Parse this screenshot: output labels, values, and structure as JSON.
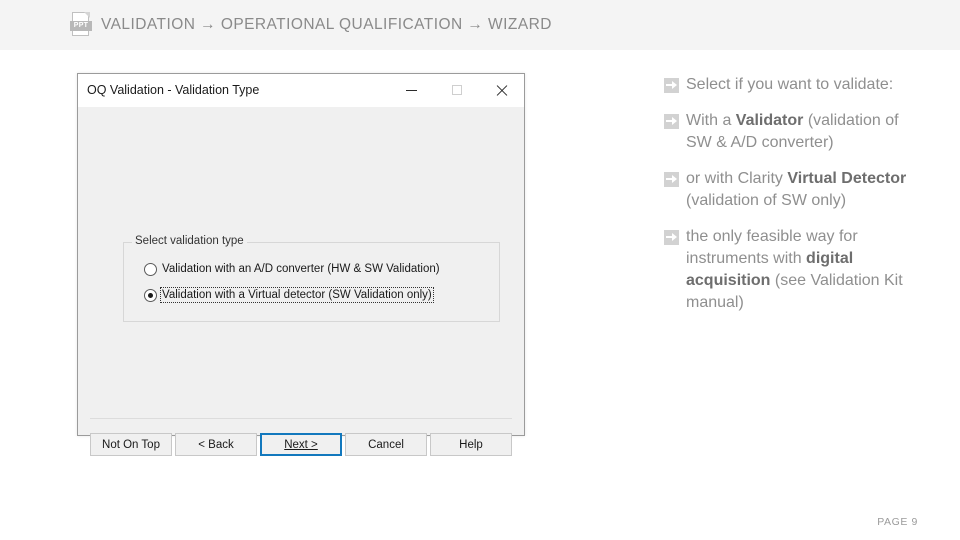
{
  "banner": {
    "icon_name": "ppt-file-icon",
    "icon_label": "PPT",
    "breadcrumb": "VALIDATION → OPERATIONAL QUALIFICATION → WIZARD"
  },
  "dialog": {
    "title": "OQ Validation - Validation Type",
    "window_controls": {
      "minimize": "—",
      "maximize": "□",
      "close": "✕"
    },
    "groupbox": {
      "label": "Select validation type",
      "options": [
        {
          "label": "Validation with an A/D converter (HW & SW Validation)",
          "selected": false,
          "focused": false
        },
        {
          "label": "Validation with a Virtual detector (SW Validation only)",
          "selected": true,
          "focused": true
        }
      ]
    },
    "buttons": [
      {
        "label": "Not On Top",
        "focused": false,
        "accel": ""
      },
      {
        "label": "< Back",
        "focused": false,
        "accel": "B"
      },
      {
        "label": "Next >",
        "focused": true,
        "accel": "N"
      },
      {
        "label": "Cancel",
        "focused": false,
        "accel": ""
      },
      {
        "label": "Help",
        "focused": false,
        "accel": ""
      }
    ]
  },
  "bullets": [
    {
      "html": "Select if you want to validate:"
    },
    {
      "html": "With a <b>Validator</b> (validation of SW &amp; A/D converter)"
    },
    {
      "html": "or with Clarity <b>Virtual Detector</b> (validation of SW only)"
    },
    {
      "html": "the only feasible way for instruments with <b>digital acquisition</b> (see Validation Kit manual)"
    }
  ],
  "footer": {
    "page_number": "PAGE 9"
  },
  "colors": {
    "banner_bg": "#f4f4f4",
    "dialog_bg": "#f0f0f0",
    "focus_blue": "#1278bd",
    "bullet_text": "#8f8f8f",
    "bullet_icon": "#d2d2d2"
  }
}
